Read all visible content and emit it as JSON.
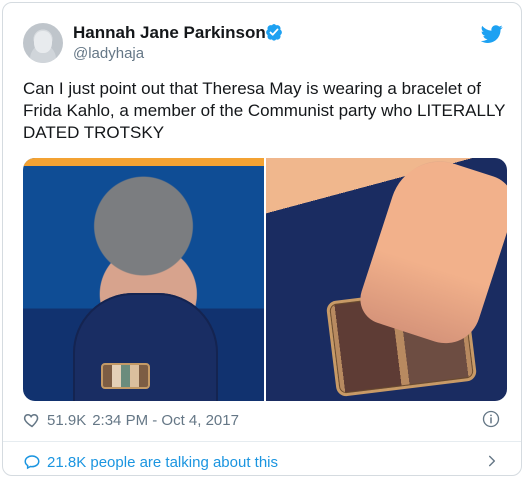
{
  "tweet": {
    "author_name": "Hannah Jane Parkinson",
    "author_handle": "@ladyhaja",
    "text": "Can I just point out that Theresa May is wearing a bracelet of Frida Kahlo, a member of the Communist party who LITERALLY DATED TROTSKY",
    "likes": "51.9K",
    "timestamp": "2:34 PM - Oct 4, 2017",
    "talking_text": "21.8K people are talking about this"
  },
  "colors": {
    "twitter_blue": "#1da1f2",
    "text_primary": "#14171a",
    "text_secondary": "#657786",
    "link_blue": "#1b95e0"
  },
  "icons": {
    "verified": "verified-badge-icon",
    "twitter": "twitter-bird-icon",
    "heart": "heart-icon",
    "info": "info-icon",
    "reply": "reply-bubble-icon",
    "chevron": "chevron-right-icon"
  }
}
